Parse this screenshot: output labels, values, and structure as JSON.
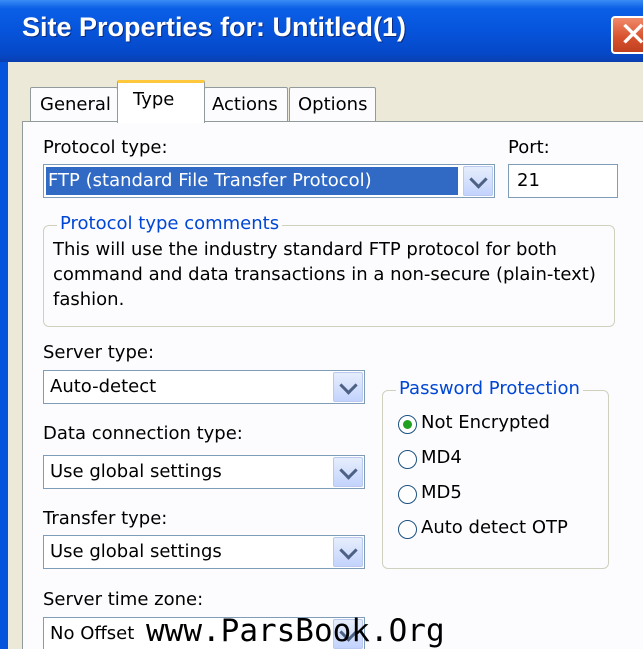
{
  "window": {
    "title": "Site Properties for: Untitled(1)",
    "close_glyph": "✕"
  },
  "tabs": [
    {
      "label": "General",
      "active": false
    },
    {
      "label": "Type",
      "active": true
    },
    {
      "label": "Actions",
      "active": false
    },
    {
      "label": "Options",
      "active": false
    }
  ],
  "protocol": {
    "label": "Protocol type:",
    "value": "FTP (standard File Transfer Protocol)",
    "port_label": "Port:",
    "port_value": "21"
  },
  "comments": {
    "legend": "Protocol type comments",
    "text": "This will use the industry standard FTP protocol for both command and data transactions in a non-secure (plain-text) fashion."
  },
  "server_type": {
    "label": "Server type:",
    "value": "Auto-detect"
  },
  "data_connection": {
    "label": "Data connection type:",
    "value": "Use global settings"
  },
  "transfer_type": {
    "label": "Transfer type:",
    "value": "Use global settings"
  },
  "time_zone": {
    "label": "Server time zone:",
    "value": "No Offset"
  },
  "password_protection": {
    "legend": "Password Protection",
    "options": [
      {
        "label": "Not Encrypted",
        "selected": true
      },
      {
        "label": "MD4",
        "selected": false
      },
      {
        "label": "MD5",
        "selected": false
      },
      {
        "label": "Auto detect OTP",
        "selected": false
      }
    ]
  },
  "watermark": "www.ParsBook.Org",
  "colors": {
    "title_bar": "#0654db",
    "selection": "#316ac5",
    "group_legend": "#0046d5",
    "radio_dot": "#21a121",
    "close": "#d9532f"
  }
}
